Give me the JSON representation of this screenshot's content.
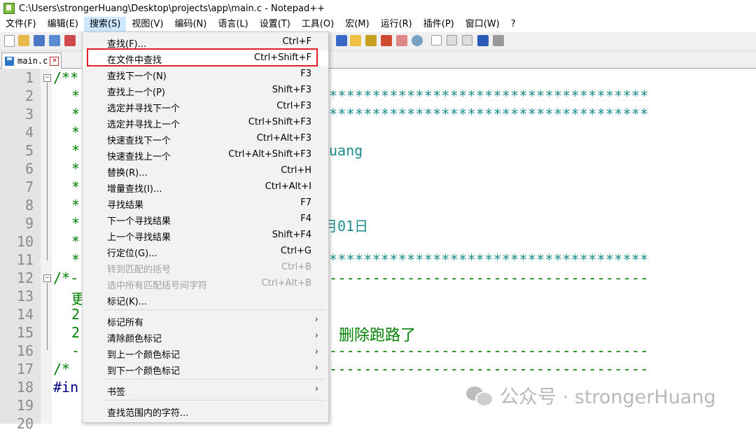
{
  "window": {
    "title": "C:\\Users\\strongerHuang\\Desktop\\projects\\app\\main.c - Notepad++"
  },
  "menubar": [
    {
      "label": "文件(F)"
    },
    {
      "label": "编辑(E)"
    },
    {
      "label": "搜索(S)",
      "active": true
    },
    {
      "label": "视图(V)"
    },
    {
      "label": "编码(N)"
    },
    {
      "label": "语言(L)"
    },
    {
      "label": "设置(T)"
    },
    {
      "label": "工具(O)"
    },
    {
      "label": "宏(M)"
    },
    {
      "label": "运行(R)"
    },
    {
      "label": "插件(P)"
    },
    {
      "label": "窗口(W)"
    },
    {
      "label": "?"
    }
  ],
  "tab": {
    "label": "main.c"
  },
  "line_numbers": [
    "1",
    "2",
    "3",
    "4",
    "5",
    "6",
    "7",
    "8",
    "9",
    "10",
    "11",
    "12",
    "13",
    "14",
    "15",
    "16",
    "17",
    "18",
    "19",
    "20"
  ],
  "code_fragments": {
    "l1": "/**",
    "l2": "*",
    "l3": "*",
    "l4": "*",
    "l5": "*",
    "l6": "*",
    "l7": "*",
    "l8": "*",
    "l9": "*",
    "l10": "*",
    "l11": "*",
    "l12": "/*-",
    "l13": "更",
    "l14": "2",
    "l15": "2",
    "l16": "-",
    "l17": "/*",
    "l18": "#in",
    "r2": "*************************************",
    "r3": "*************************************",
    "r5": "uang",
    "r9": "月01日",
    "r11": "*************************************",
    "r12": "-------------------------------------",
    "r15": "，删除跑路了",
    "r16": "-------------------------------------",
    "r17": "-------------------------------------"
  },
  "search_menu": {
    "items": [
      {
        "label": "查找(F)...",
        "shortcut": "Ctrl+F"
      },
      {
        "label": "在文件中查找",
        "shortcut": "Ctrl+Shift+F",
        "highlighted": true
      },
      {
        "label": "查找下一个(N)",
        "shortcut": "F3"
      },
      {
        "label": "查找上一个(P)",
        "shortcut": "Shift+F3"
      },
      {
        "label": "选定并寻找下一个",
        "shortcut": "Ctrl+F3"
      },
      {
        "label": "选定并寻找上一个",
        "shortcut": "Ctrl+Shift+F3"
      },
      {
        "label": "快速查找下一个",
        "shortcut": "Ctrl+Alt+F3"
      },
      {
        "label": "快速查找上一个",
        "shortcut": "Ctrl+Alt+Shift+F3"
      },
      {
        "label": "替换(R)...",
        "shortcut": "Ctrl+H"
      },
      {
        "label": "增量查找(I)...",
        "shortcut": "Ctrl+Alt+I"
      },
      {
        "label": "寻找结果",
        "shortcut": "F7"
      },
      {
        "label": "下一个寻找结果",
        "shortcut": "F4"
      },
      {
        "label": "上一个寻找结果",
        "shortcut": "Shift+F4"
      },
      {
        "label": "行定位(G)...",
        "shortcut": "Ctrl+G"
      },
      {
        "label": "转到匹配的括号",
        "shortcut": "Ctrl+B",
        "disabled": true
      },
      {
        "label": "选中所有匹配括号间字符",
        "shortcut": "Ctrl+Alt+B",
        "disabled": true
      },
      {
        "label": "标记(K)...",
        "shortcut": ""
      },
      {
        "label": "标记所有",
        "submenu": true
      },
      {
        "label": "清除颜色标记",
        "submenu": true
      },
      {
        "label": "到上一个颜色标记",
        "submenu": true
      },
      {
        "label": "到下一个颜色标记",
        "submenu": true
      },
      {
        "label": "书签",
        "submenu": true
      },
      {
        "label": "查找范围内的字符..."
      }
    ]
  },
  "watermark": {
    "text": "公众号 · strongerHuang"
  }
}
